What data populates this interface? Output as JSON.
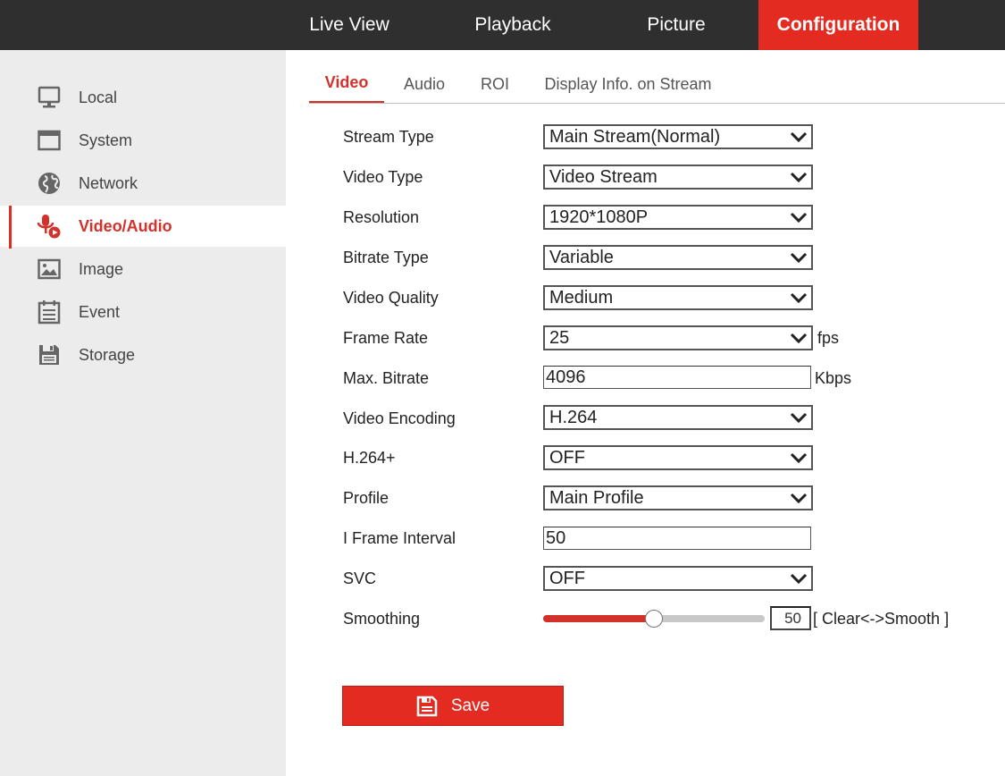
{
  "topnav": {
    "items": [
      {
        "label": "Live View"
      },
      {
        "label": "Playback"
      },
      {
        "label": "Picture"
      },
      {
        "label": "Configuration",
        "active": true
      }
    ]
  },
  "sidebar": {
    "items": [
      {
        "label": "Local",
        "icon": "monitor-icon"
      },
      {
        "label": "System",
        "icon": "window-icon"
      },
      {
        "label": "Network",
        "icon": "globe-icon"
      },
      {
        "label": "Video/Audio",
        "icon": "microphone-icon",
        "active": true
      },
      {
        "label": "Image",
        "icon": "image-icon"
      },
      {
        "label": "Event",
        "icon": "calendar-list-icon"
      },
      {
        "label": "Storage",
        "icon": "floppy-disk-icon"
      }
    ]
  },
  "tabs": [
    {
      "label": "Video",
      "active": true
    },
    {
      "label": "Audio"
    },
    {
      "label": "ROI"
    },
    {
      "label": "Display Info. on Stream"
    }
  ],
  "form": {
    "stream_type": {
      "label": "Stream Type",
      "value": "Main Stream(Normal)"
    },
    "video_type": {
      "label": "Video Type",
      "value": "Video Stream"
    },
    "resolution": {
      "label": "Resolution",
      "value": "1920*1080P"
    },
    "bitrate_type": {
      "label": "Bitrate Type",
      "value": "Variable"
    },
    "video_quality": {
      "label": "Video Quality",
      "value": "Medium"
    },
    "frame_rate": {
      "label": "Frame Rate",
      "value": "25",
      "unit": "fps"
    },
    "max_bitrate": {
      "label": "Max. Bitrate",
      "value": "4096",
      "unit": "Kbps"
    },
    "video_encoding": {
      "label": "Video Encoding",
      "value": "H.264"
    },
    "h264plus": {
      "label": "H.264+",
      "value": "OFF"
    },
    "profile": {
      "label": "Profile",
      "value": "Main Profile"
    },
    "i_frame_interval": {
      "label": "I Frame Interval",
      "value": "50"
    },
    "svc": {
      "label": "SVC",
      "value": "OFF"
    },
    "smoothing": {
      "label": "Smoothing",
      "value": "50",
      "level_fraction": 0.5,
      "range_label": "[ Clear<->Smooth ]"
    }
  },
  "save_button": {
    "label": "Save",
    "icon": "floppy-disk-icon"
  },
  "colors": {
    "accent": "#e32b21",
    "topbar": "#2f2f2f",
    "sidebar": "#ececec"
  }
}
